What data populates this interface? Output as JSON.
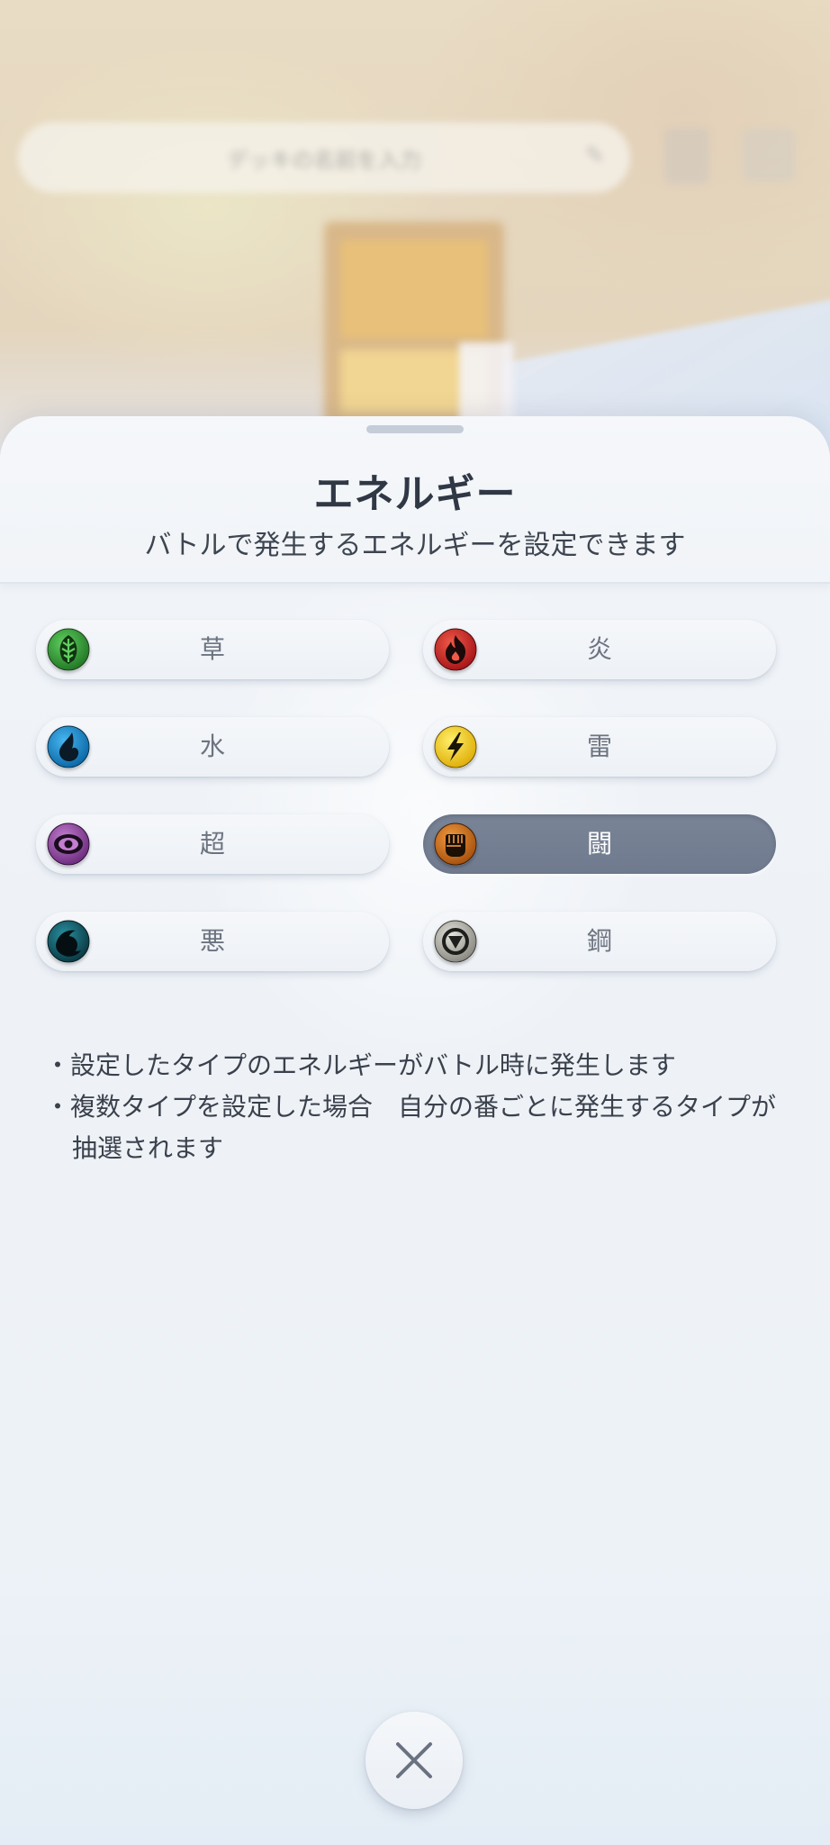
{
  "background": {
    "search_placeholder": "デッキの名前を入力",
    "pencil_icon": "pencil-icon",
    "trash_icon": "trash-icon",
    "close_icon": "close-icon"
  },
  "sheet": {
    "title": "エネルギー",
    "subtitle": "バトルで発生するエネルギーを設定できます"
  },
  "energy_types": [
    {
      "label": "草",
      "icon": "grass-energy-icon",
      "color": "#3a9b3a",
      "selected": false
    },
    {
      "label": "炎",
      "icon": "fire-energy-icon",
      "color": "#d8322a",
      "selected": false
    },
    {
      "label": "水",
      "icon": "water-energy-icon",
      "color": "#1e8fd6",
      "selected": false
    },
    {
      "label": "雷",
      "icon": "lightning-energy-icon",
      "color": "#f2cf1e",
      "selected": false
    },
    {
      "label": "超",
      "icon": "psychic-energy-icon",
      "color": "#9a4fa6",
      "selected": false
    },
    {
      "label": "闘",
      "icon": "fighting-energy-icon",
      "color": "#d0731f",
      "selected": true
    },
    {
      "label": "悪",
      "icon": "darkness-energy-icon",
      "color": "#0f5d6c",
      "selected": false
    },
    {
      "label": "鋼",
      "icon": "metal-energy-icon",
      "color": "#a9a9a1",
      "selected": false
    }
  ],
  "notes": [
    "・設定したタイプのエネルギーがバトル時に発生します",
    "・複数タイプを設定した場合　自分の番ごとに発生するタイプが抽選されます"
  ],
  "close_button": {
    "icon": "close-icon"
  }
}
